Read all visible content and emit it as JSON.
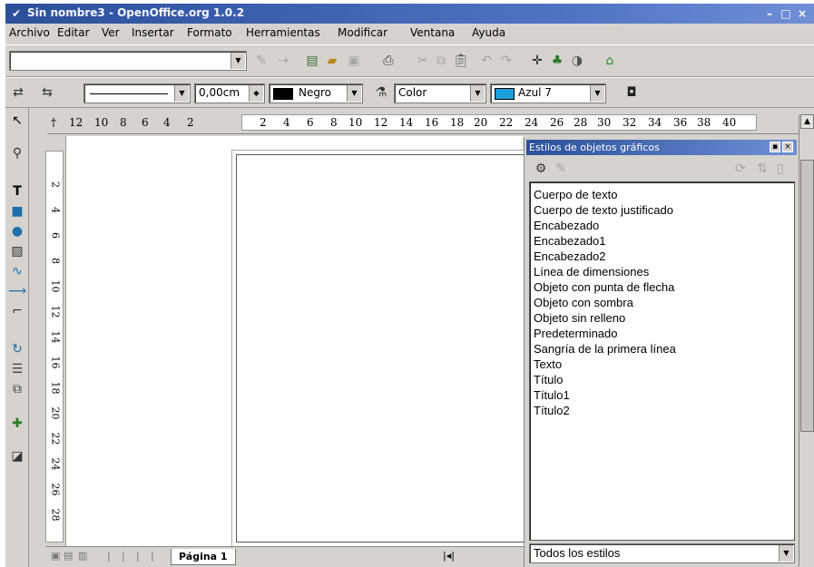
{
  "window": {
    "title": "Sin nombre3 - OpenOffice.org 1.0.2",
    "controls": [
      "–",
      "□",
      "×"
    ]
  },
  "menu": [
    "Archivo",
    "Editar",
    "Ver",
    "Insertar",
    "Formato",
    "Herramientas",
    "Modificar",
    "Ventana",
    "Ayuda"
  ],
  "toolbar2": {
    "line_width": "0,00cm",
    "line_color": "Negro",
    "line_color_hex": "#000000",
    "area_style": "Color",
    "fill_color": "Azul 7",
    "fill_color_hex": "#1e9ed8"
  },
  "ruler": {
    "horizontal": [
      "12",
      "10",
      "8",
      "6",
      "4",
      "2",
      "2",
      "4",
      "6",
      "8",
      "10",
      "12",
      "14",
      "16",
      "18",
      "20",
      "22",
      "24",
      "26",
      "28",
      "30",
      "32",
      "34",
      "36",
      "38",
      "40"
    ],
    "vertical": [
      "2",
      "4",
      "6",
      "8",
      "10",
      "12",
      "14",
      "16",
      "18",
      "20",
      "22",
      "24",
      "26",
      "28"
    ]
  },
  "page_tab": "Página 1",
  "styles_panel": {
    "title": "Estilos de objetos gráficos",
    "items": [
      "Cuerpo de texto",
      "Cuerpo de texto justificado",
      "Encabezado",
      "Encabezado1",
      "Encabezado2",
      "Línea de dimensiones",
      "Objeto con punta de flecha",
      "Objeto con sombra",
      "Objeto sin relleno",
      "Predeterminado",
      "Sangría de la primera línea",
      "Texto",
      "Título",
      "Título1",
      "Título2"
    ],
    "filter": "Todos los estilos"
  }
}
